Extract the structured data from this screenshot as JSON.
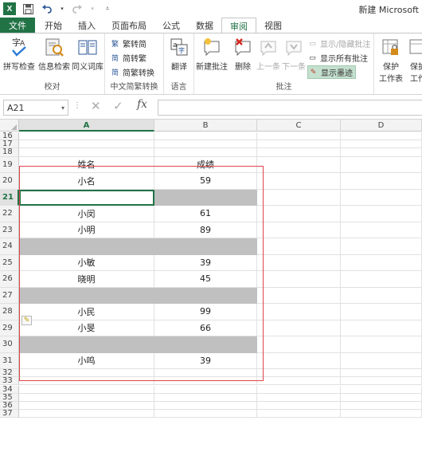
{
  "quick_access": {
    "app_icon": "excel-icon",
    "app_letter": "X",
    "save_icon": "save-icon",
    "undo_icon": "undo-icon",
    "redo_icon": "redo-icon",
    "customize_icon": "dropdown-icon"
  },
  "window_title": "新建 Microsoft",
  "tabs": [
    {
      "label": "文件",
      "kind": "file"
    },
    {
      "label": "开始"
    },
    {
      "label": "插入"
    },
    {
      "label": "页面布局"
    },
    {
      "label": "公式"
    },
    {
      "label": "数据"
    },
    {
      "label": "审阅",
      "active": true
    },
    {
      "label": "视图"
    }
  ],
  "ribbon": {
    "groups": [
      {
        "label": "校对",
        "buttons": [
          "拼写检查",
          "信息检索",
          "同义词库"
        ]
      },
      {
        "label": "中文简繁转换",
        "buttons": [
          "繁转简",
          "简转繁",
          "简繁转换"
        ]
      },
      {
        "label": "语言",
        "buttons": [
          "翻译"
        ]
      },
      {
        "label": "批注",
        "buttons": [
          "新建批注",
          "删除",
          "上一条",
          "下一条"
        ],
        "side_buttons": [
          "显示/隐藏批注",
          "显示所有批注",
          "显示墨迹"
        ]
      },
      {
        "label": "",
        "buttons": [
          "保护",
          "工作表"
        ]
      },
      {
        "label": "",
        "buttons": [
          "保护",
          "工作"
        ]
      }
    ],
    "accent": "#217346"
  },
  "formula_bar": {
    "name_box": "A21",
    "fx": "fx",
    "content": ""
  },
  "columns": [
    "A",
    "B",
    "C",
    "D"
  ],
  "selected_column": "A",
  "rows": [
    {
      "num": "16",
      "a": "",
      "b": ""
    },
    {
      "num": "17",
      "a": "",
      "b": ""
    },
    {
      "num": "18",
      "a": "",
      "b": ""
    },
    {
      "num": "19",
      "a": "姓名",
      "b": "成绩"
    },
    {
      "num": "20",
      "a": "小名",
      "b": "59"
    },
    {
      "num": "21",
      "a": "",
      "b": "",
      "gray": true,
      "selected": true
    },
    {
      "num": "22",
      "a": "小闵",
      "b": "61"
    },
    {
      "num": "23",
      "a": "小明",
      "b": "89"
    },
    {
      "num": "24",
      "a": "",
      "b": "",
      "gray": true
    },
    {
      "num": "25",
      "a": "小敏",
      "b": "39"
    },
    {
      "num": "26",
      "a": "晓明",
      "b": "45"
    },
    {
      "num": "27",
      "a": "",
      "b": "",
      "gray": true
    },
    {
      "num": "28",
      "a": "小民",
      "b": "99"
    },
    {
      "num": "29",
      "a": "小旻",
      "b": "66"
    },
    {
      "num": "30",
      "a": "",
      "b": "",
      "gray": true
    },
    {
      "num": "31",
      "a": "小鸣",
      "b": "39"
    },
    {
      "num": "32",
      "a": "",
      "b": ""
    },
    {
      "num": "33",
      "a": "",
      "b": ""
    },
    {
      "num": "34",
      "a": "",
      "b": ""
    },
    {
      "num": "35",
      "a": "",
      "b": ""
    },
    {
      "num": "36",
      "a": "",
      "b": ""
    },
    {
      "num": "37",
      "a": "",
      "b": ""
    }
  ]
}
